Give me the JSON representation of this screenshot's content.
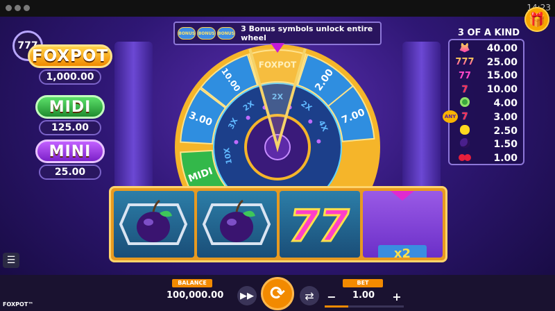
{
  "status_bar": {
    "time": "14:23"
  },
  "jackpots": {
    "badge": "777",
    "foxpot": {
      "label": "FOXPOT",
      "value": "1,000.00"
    },
    "midi": {
      "label": "MIDI",
      "value": "125.00"
    },
    "mini": {
      "label": "MINI",
      "value": "25.00"
    }
  },
  "banner": {
    "chip_label": "BONUS",
    "text": "3 Bonus symbols unlock entire wheel"
  },
  "wheel": {
    "outer_segments": [
      "10.00",
      "FOXPOT",
      "2.00",
      "7.00",
      "3.00",
      "MIDI"
    ],
    "inner_segments": [
      "2X",
      "2X",
      "4X",
      "2X",
      "3X",
      "10X"
    ]
  },
  "paytable": {
    "title": "3 OF A KIND",
    "any_label": "ANY",
    "rows": [
      {
        "symbol": "fox-7",
        "value": "40.00"
      },
      {
        "symbol": "triple-7",
        "value": "25.00"
      },
      {
        "symbol": "double-7",
        "value": "15.00"
      },
      {
        "symbol": "single-7",
        "value": "10.00"
      },
      {
        "symbol": "watermelon",
        "value": "4.00"
      },
      {
        "symbol": "any-7",
        "value": "3.00"
      },
      {
        "symbol": "lemon",
        "value": "2.50"
      },
      {
        "symbol": "plum",
        "value": "1.50"
      },
      {
        "symbol": "cherry",
        "value": "1.00"
      }
    ]
  },
  "reels": [
    {
      "symbol": "plum"
    },
    {
      "symbol": "plum"
    },
    {
      "symbol": "double-7",
      "text": "77"
    },
    {
      "symbol": "multiplier",
      "text": "x2"
    }
  ],
  "controls": {
    "balance_label": "BALANCE",
    "balance_value": "100,000.00",
    "bet_label": "BET",
    "bet_value": "1.00",
    "minus": "−",
    "plus": "+"
  },
  "brand": "FOXPOT™",
  "colors": {
    "accent": "#f28a00",
    "wheel_blue": "#2f8ee0",
    "wheel_gold": "#f5b52a"
  }
}
